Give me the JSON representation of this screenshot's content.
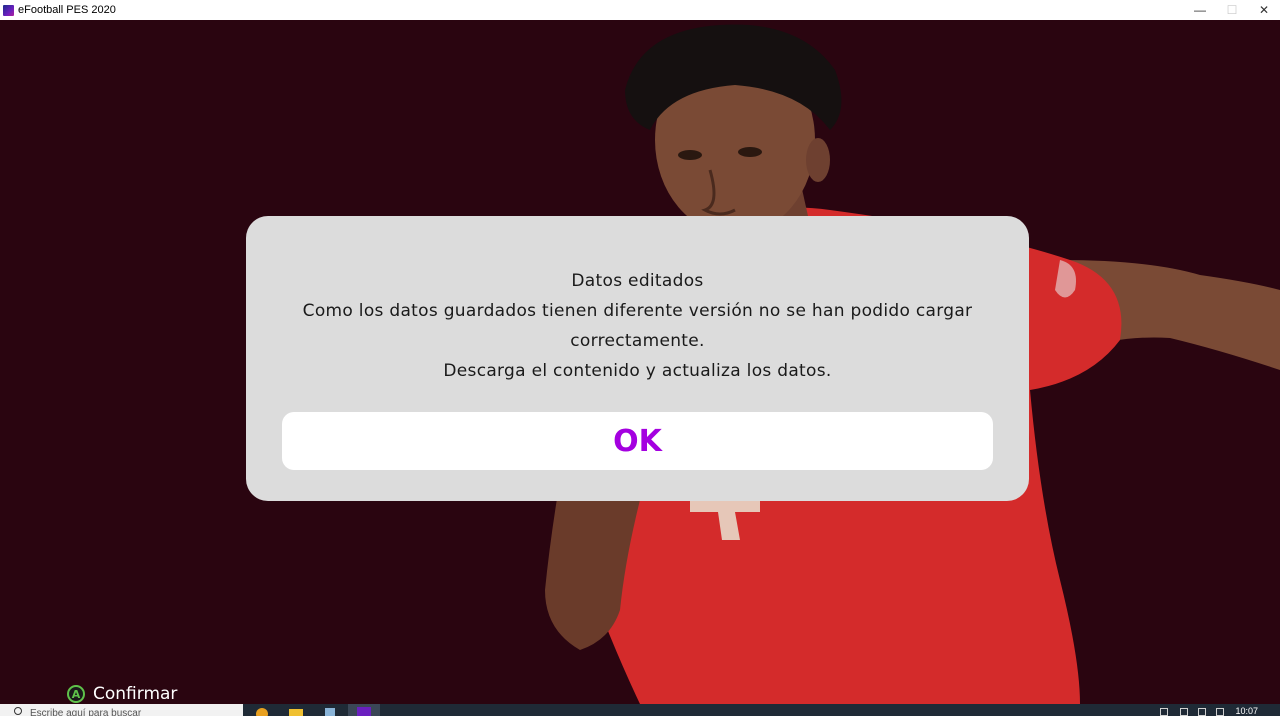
{
  "window": {
    "title": "eFootball PES 2020",
    "controls": {
      "minimize": "—",
      "maximize": "☐",
      "close": "✕"
    }
  },
  "dialog": {
    "heading": "Datos editados",
    "message_lines": [
      "Como los datos guardados tienen diferente versión no se han podido cargar",
      "correctamente.",
      "Descarga el contenido y actualiza los datos."
    ],
    "ok_label": "OK"
  },
  "hint": {
    "button_glyph": "A",
    "label": "Confirmar"
  },
  "taskbar": {
    "search_placeholder": "Escribe aquí para buscar",
    "clock": "10:07"
  },
  "colors": {
    "background": "#2a0510",
    "dialog_bg": "#dcdcdc",
    "ok_text": "#a400e0",
    "jersey": "#d42b2b",
    "button_a": "#5fc24a"
  }
}
